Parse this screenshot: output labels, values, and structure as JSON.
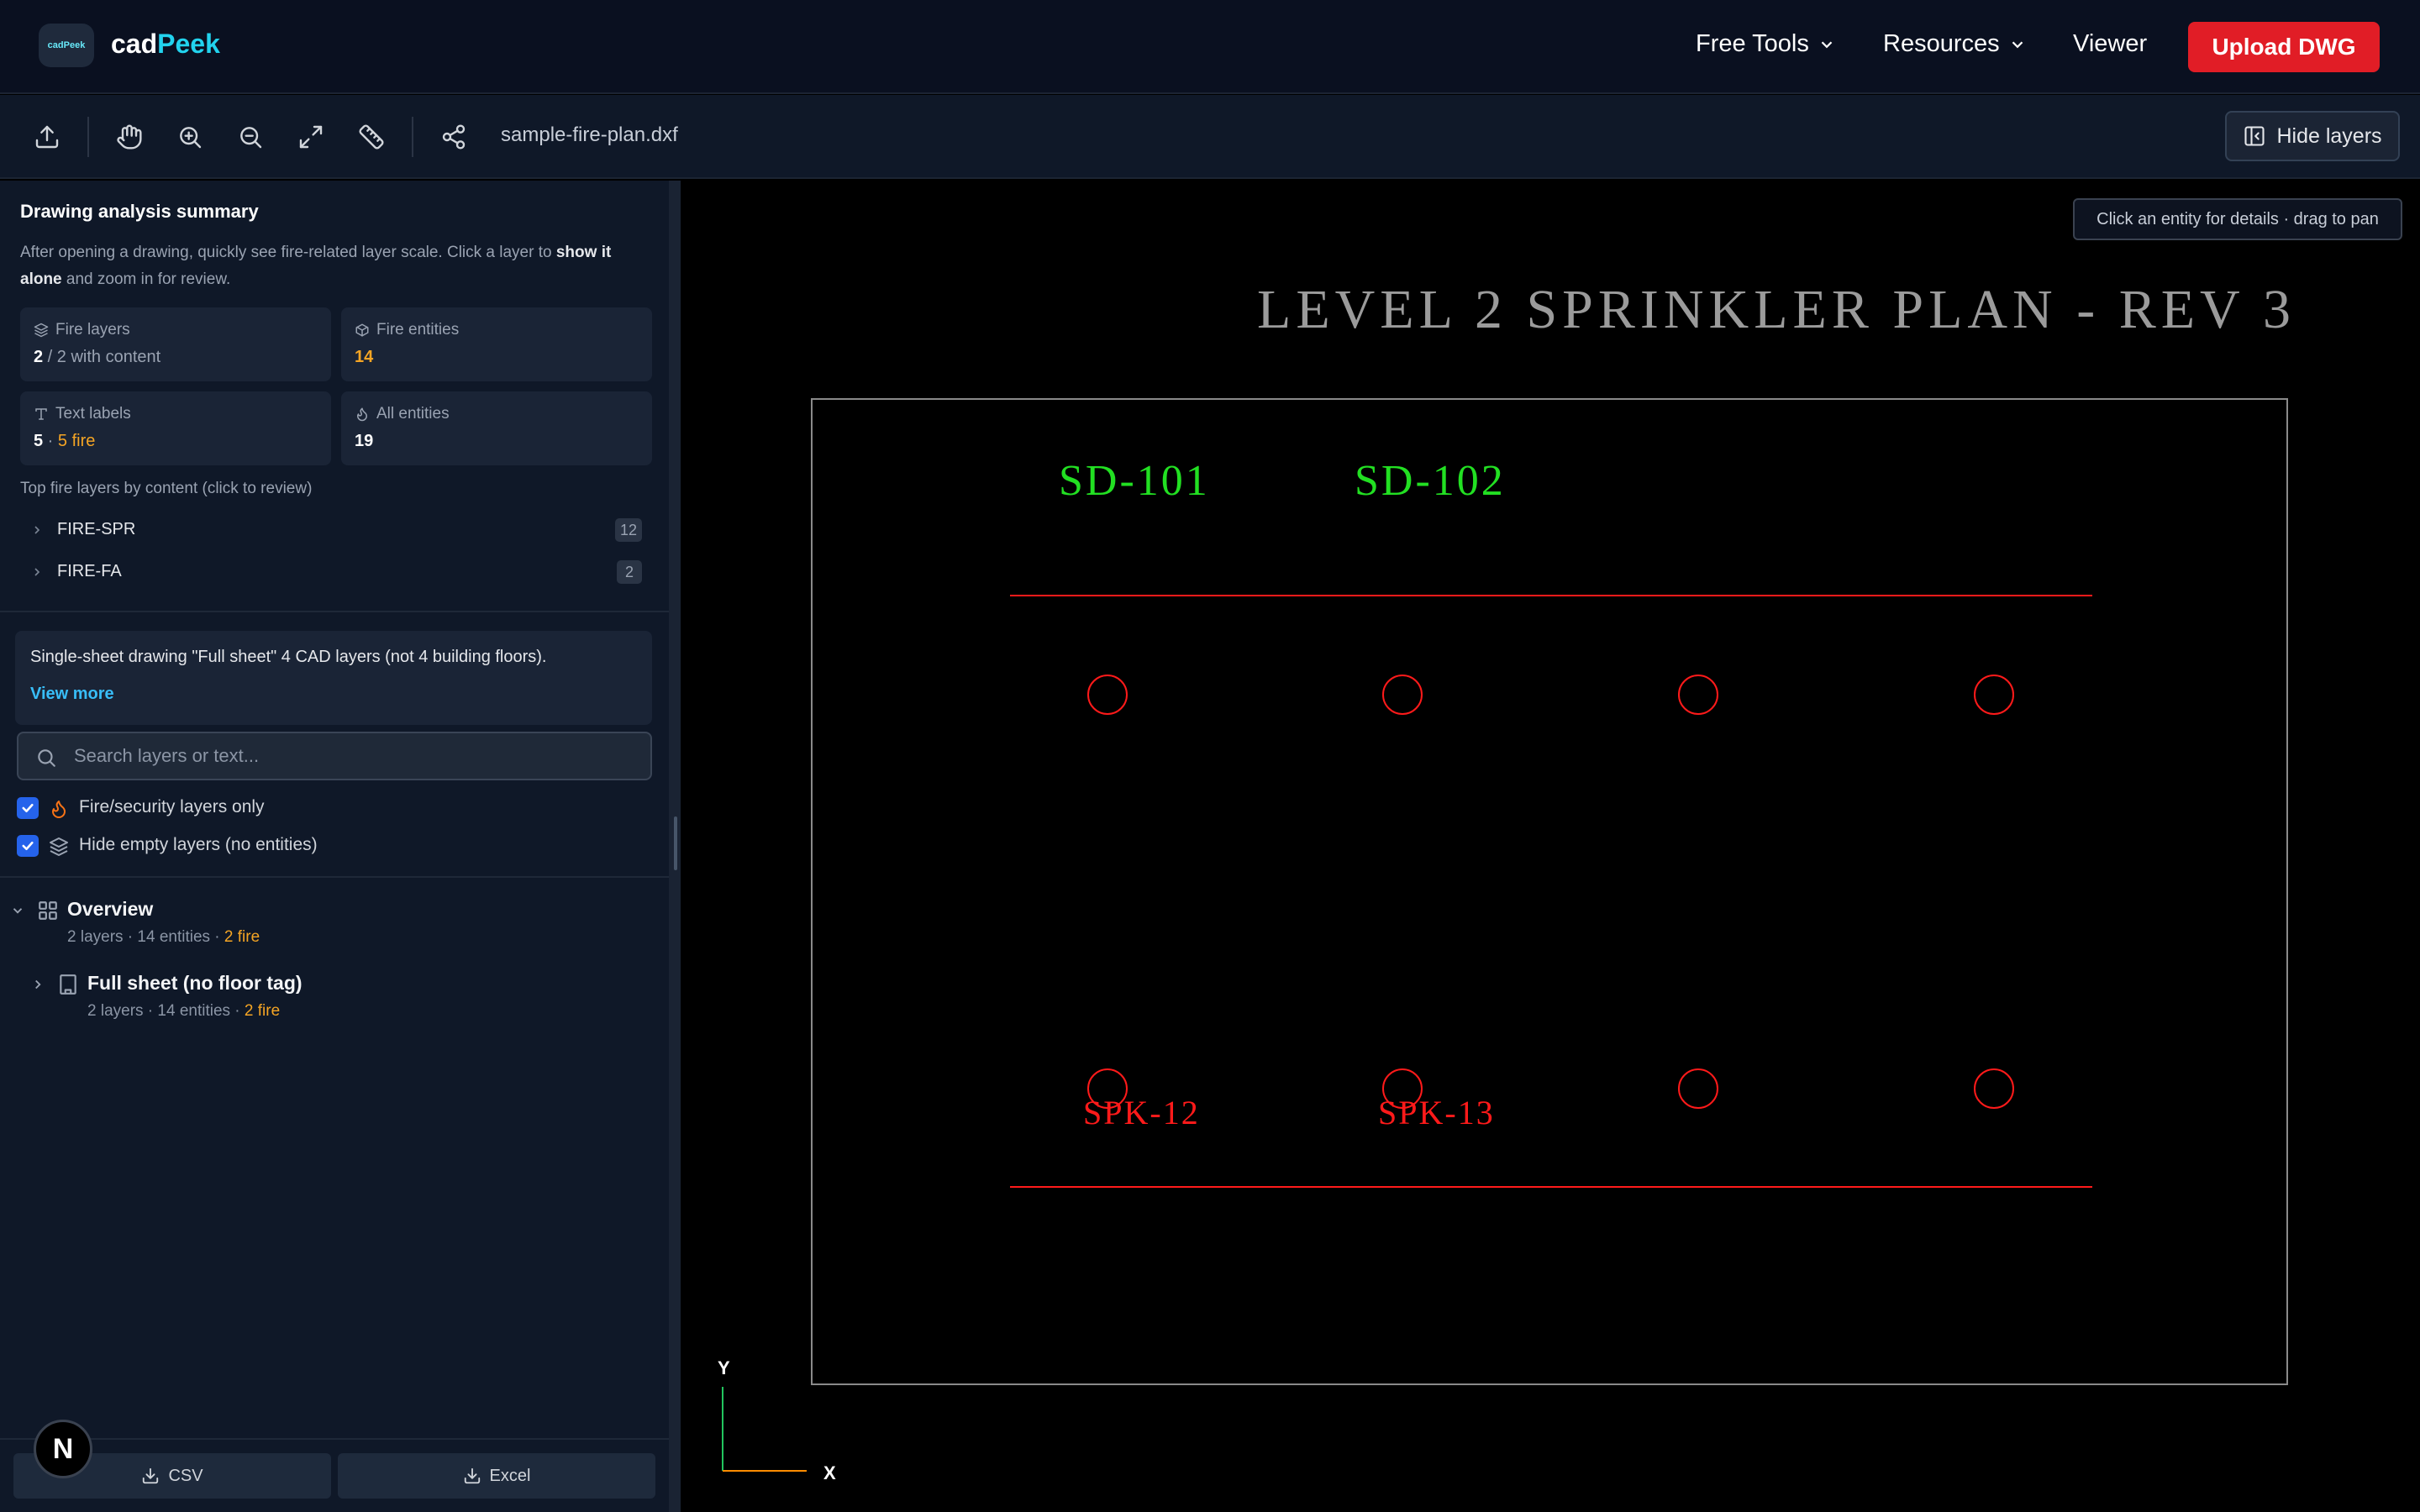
{
  "nav": {
    "brand_part1": "cad",
    "brand_part2": "Peek",
    "logo_text": "cadPeek",
    "free_tools": "Free Tools",
    "resources": "Resources",
    "viewer": "Viewer",
    "upload": "Upload DWG"
  },
  "toolbar": {
    "filename": "sample-fire-plan.dxf",
    "hide_layers": "Hide layers",
    "icons": [
      "upload-icon",
      "hand-icon",
      "zoom-in-icon",
      "zoom-out-icon",
      "expand-icon",
      "ruler-icon",
      "share-icon"
    ]
  },
  "summary": {
    "title": "Drawing analysis summary",
    "desc_1": "After opening a drawing, quickly see fire-related layer scale. Click a layer to ",
    "desc_bold": "show it alone",
    "desc_2": " and zoom in for review.",
    "cards": {
      "fire_layers": {
        "label": "Fire layers",
        "value": "2",
        "rest": " / 2 with content"
      },
      "fire_entities": {
        "label": "Fire entities",
        "value": "14"
      },
      "text_labels": {
        "label": "Text labels",
        "value": "5",
        "sep": " · ",
        "fire": "5 fire"
      },
      "all_entities": {
        "label": "All entities",
        "value": "19"
      }
    },
    "top_fire_label": "Top fire layers by content (click to review)",
    "layers": [
      {
        "name": "FIRE-SPR",
        "count": "12"
      },
      {
        "name": "FIRE-FA",
        "count": "2"
      }
    ]
  },
  "info": {
    "text": "Single-sheet drawing \"Full sheet\" 4 CAD layers (not 4 building floors).",
    "view_more": "View more"
  },
  "search": {
    "placeholder": "Search layers or text..."
  },
  "filters": {
    "fire_only": "Fire/security layers only",
    "hide_empty": "Hide empty layers (no entities)"
  },
  "tree": {
    "overview": {
      "title": "Overview",
      "sub": "2 layers · 14 entities · ",
      "fire": "2 fire"
    },
    "sheet": {
      "title": "Full sheet (no floor tag)",
      "sub": "2 layers · 14 entities · ",
      "fire": "2 fire"
    }
  },
  "bottom": {
    "csv": "CSV",
    "excel": "Excel",
    "badge": "N"
  },
  "canvas": {
    "hint": "Click an entity for details · drag to pan",
    "title": "LEVEL 2 SPRINKLER PLAN - REV 3",
    "labels": [
      "SD-101",
      "SD-102",
      "SPK-12",
      "SPK-13"
    ],
    "axis_y": "Y",
    "axis_x": "X",
    "colors": {
      "fire": "#ff1a1a",
      "detector": "#22e022",
      "title": "#9b9b9b"
    }
  }
}
